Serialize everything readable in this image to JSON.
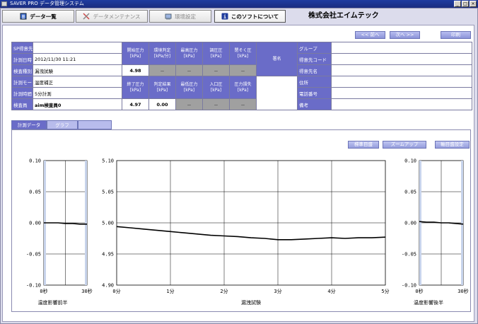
{
  "window": {
    "title": "SAVER PRO データ管理システム",
    "controls": [
      "_",
      "□",
      "×"
    ]
  },
  "toolbar": {
    "data_list": "データ一覧",
    "maintenance": "データメンテナンス",
    "env_settings": "環境設定",
    "about": "このソフトについて",
    "company": "株式会社エイムテック"
  },
  "nav": {
    "prev": "<< 前へ",
    "next": "次へ >>",
    "print": "印刷"
  },
  "info": {
    "labels": {
      "sp_dest": "SP得意先名",
      "datetime": "計測日時",
      "inspection_type": "検査種別",
      "mode": "計測モード",
      "duration": "計測時間",
      "inspector": "検査員"
    },
    "values": {
      "sp_dest": "",
      "datetime": "2012/11/30  11:21",
      "inspection_type": "漏洩試験",
      "mode": "温度補正",
      "duration": "5分計測",
      "inspector": "aim検査員0"
    },
    "top_headers": [
      "開始圧力\n[kPa]",
      "環境判定\n[kPa/分]",
      "最高圧力\n[kPa]",
      "調圧圧\n[kPa]",
      "閉そく圧\n[kPa]"
    ],
    "top_values": [
      "4.98",
      "－",
      "－",
      "－",
      "－"
    ],
    "bottom_headers": [
      "終了圧力\n[kPa]",
      "判定結果\n[kPa]",
      "最低圧力\n[kPa]",
      "入口圧\n[kPa]",
      "圧力損失\n[kPa]"
    ],
    "bottom_values": [
      "4.97",
      "0.00",
      "－",
      "－",
      "－"
    ],
    "signature": "署名",
    "right_labels": [
      "グループ",
      "得意先コード",
      "得意先名",
      "住所",
      "電話番号",
      "備考"
    ]
  },
  "tabs": [
    "計測データ",
    "グラフ"
  ],
  "graph_buttons": {
    "standard": "標準目盛",
    "zoom": "ズームアップ",
    "axis": "軸目盛設定"
  },
  "colors": {
    "header_blue": "#6a6cc8",
    "line": "#000000",
    "dash_cell": "#a0a0a0"
  },
  "chart_data": [
    {
      "type": "line",
      "title": "",
      "xlabel": "温度影響前半",
      "x_ticks": [
        "0秒",
        "30秒"
      ],
      "ylim": [
        -0.1,
        0.1
      ],
      "y_ticks": [
        "0.10",
        "0.05",
        "0.00",
        "-0.05",
        "-0.10"
      ],
      "grid": true,
      "series": [
        {
          "x": [
            0,
            5,
            10,
            15,
            20,
            25,
            30
          ],
          "y": [
            0.0,
            0.0,
            0.0,
            -0.001,
            -0.001,
            -0.002,
            -0.002
          ]
        }
      ]
    },
    {
      "type": "line",
      "title": "",
      "xlabel": "漏洩試験",
      "x_ticks": [
        "0分",
        "1分",
        "2分",
        "3分",
        "4分",
        "5分"
      ],
      "ylim": [
        4.9,
        5.1
      ],
      "y_ticks": [
        "5.10",
        "5.05",
        "5.00",
        "4.95",
        "4.90"
      ],
      "grid": true,
      "series": [
        {
          "x": [
            0,
            0.25,
            0.5,
            0.75,
            1,
            1.25,
            1.5,
            1.75,
            2,
            2.25,
            2.5,
            2.75,
            3,
            3.25,
            3.5,
            3.75,
            4,
            4.25,
            4.5,
            4.75,
            5
          ],
          "y": [
            4.994,
            4.992,
            4.99,
            4.988,
            4.986,
            4.984,
            4.982,
            4.98,
            4.979,
            4.978,
            4.976,
            4.975,
            4.973,
            4.973,
            4.974,
            4.975,
            4.976,
            4.975,
            4.976,
            4.976,
            4.977
          ]
        }
      ]
    },
    {
      "type": "line",
      "title": "",
      "xlabel": "温度影響後半",
      "x_ticks": [
        "0秒",
        "30秒"
      ],
      "ylim": [
        -0.1,
        0.1
      ],
      "y_ticks": [
        "0.10",
        "0.05",
        "0.00",
        "-0.05",
        "-0.10"
      ],
      "grid": true,
      "series": [
        {
          "x": [
            0,
            5,
            10,
            15,
            20,
            25,
            30
          ],
          "y": [
            0.002,
            0.001,
            0.001,
            0.0,
            0.0,
            -0.001,
            -0.002
          ]
        }
      ]
    }
  ]
}
